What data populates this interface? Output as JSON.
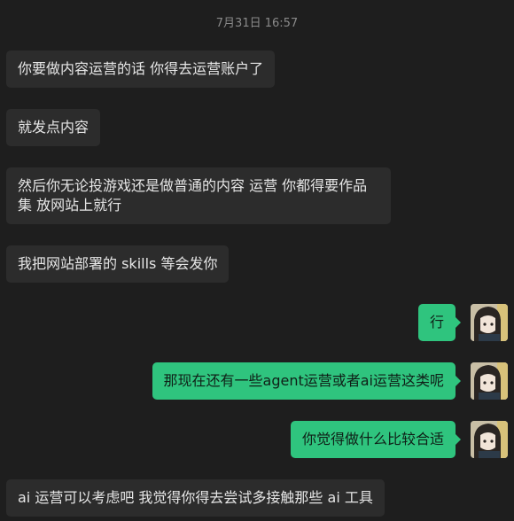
{
  "chat": {
    "timestamp": "7月31日 16:57",
    "messages": [
      {
        "from": "other",
        "text": "你要做内容运营的话 你得去运营账户了"
      },
      {
        "from": "other",
        "text": "就发点内容"
      },
      {
        "from": "other",
        "text": "然后你无论投游戏还是做普通的内容 运营 你都得要作品集 放网站上就行"
      },
      {
        "from": "other",
        "text": "我把网站部署的 skills 等会发你"
      },
      {
        "from": "me",
        "text": "行"
      },
      {
        "from": "me",
        "text": "那现在还有一些agent运营或者ai运营这类呢"
      },
      {
        "from": "me",
        "text": "你觉得做什么比较合适"
      },
      {
        "from": "other",
        "text": "ai 运营可以考虑吧 我觉得你得去尝试多接触那些 ai 工具"
      }
    ]
  },
  "colors": {
    "background": "#1e1e1e",
    "incoming_bubble": "#2c2c2c",
    "outgoing_bubble": "#2fc47e"
  }
}
